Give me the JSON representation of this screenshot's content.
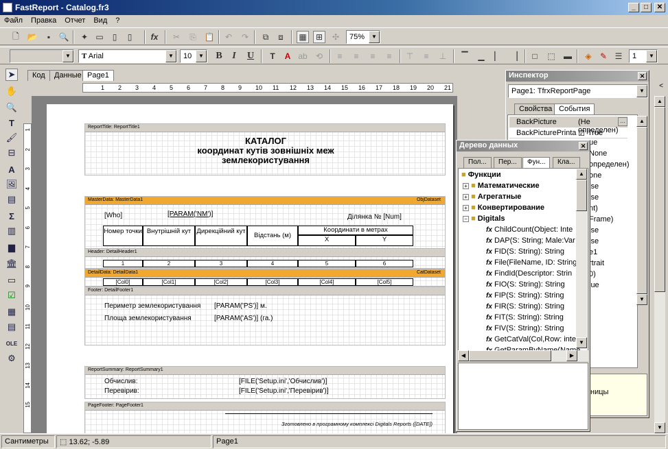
{
  "window": {
    "title": "FastReport - Catalog.fr3",
    "min": "_",
    "max": "□",
    "close": "✕"
  },
  "menu": [
    "Файл",
    "Правка",
    "Отчет",
    "Вид",
    "?"
  ],
  "toolbar": {
    "zoom": "75%",
    "font": "Arial",
    "size": "10",
    "linewidth": "1",
    "bold": "B",
    "italic": "I",
    "underline": "U"
  },
  "tabs": [
    "Код",
    "Данные",
    "Page1"
  ],
  "ruler": [
    "1",
    "2",
    "3",
    "4",
    "5",
    "6",
    "7",
    "8",
    "9",
    "10",
    "11",
    "12",
    "13",
    "14",
    "15",
    "16",
    "17",
    "18",
    "19",
    "20",
    "21"
  ],
  "vruler": [
    "1",
    "2",
    "3",
    "4",
    "5",
    "6",
    "7",
    "8",
    "9",
    "10",
    "11",
    "12",
    "13",
    "14",
    "15"
  ],
  "report": {
    "title_band": "ReportTitle: ReportTitle1",
    "title_lines": [
      "КАТАЛОГ",
      "координат кутів зовнішніх меж",
      "землекористування"
    ],
    "master_band": "MasterData: MasterData1",
    "master_ds": "ObjDataset",
    "who": "[Who]",
    "nm": "[PARAM('NM')]",
    "dilanka": "Ділянка № [Num]",
    "headers": [
      "Номер точки",
      "Внутрішній кут",
      "Дирекційний кут",
      "Відстань (м)",
      "Координати в метрах",
      "X",
      "Y"
    ],
    "header_band": "Header: DetailHeader1",
    "nums": [
      "1",
      "2",
      "3",
      "4",
      "5",
      "6"
    ],
    "detail_band": "DetailData: DetailData1",
    "detail_ds": "CatDataset",
    "cols": [
      "[Col0]",
      "[Col1]",
      "[Col2]",
      "[Col3]",
      "[Col4]",
      "[Col5]"
    ],
    "footer_band": "Footer: DetailFooter1",
    "perimetr": "Периметр землекористування",
    "perimetr_val": "[PARAM('PS')] м.",
    "plosha": "Площа землекористування",
    "plosha_val": "[PARAM('AS')] (га.)",
    "summary_band": "ReportSummary: ReportSummary1",
    "obchyslyv": "Обчислив:",
    "obchyslyv_val": "[FILE('Setup.ini','Обчислив')]",
    "pereviryv": "Перевірив:",
    "pereviryv_val": "[FILE('Setup.ini','Перевірив')]",
    "pagefooter_band": "PageFooter: PageFooter1",
    "pagefooter_text": "Зготовлено в програмному комплексі Digitals Reports ([DATE])"
  },
  "inspector": {
    "title": "Инспектор",
    "object": "Page1: TfrxReportPage",
    "tab_props": "Свойства",
    "tab_events": "События",
    "rows": [
      {
        "name": "BackPicture",
        "value": "(Не определен)"
      },
      {
        "name": "BackPicturePrinta",
        "value": "True"
      }
    ],
    "partial_values": [
      "ue",
      "None",
      "определен)",
      "one",
      "lse",
      "lse",
      "nt)",
      "Frame)",
      "lse",
      "lse",
      "e1",
      "rtrait",
      "0)",
      "lue"
    ],
    "desc": "ницы"
  },
  "datatree": {
    "title": "Дерево данных",
    "tabs": [
      "Пол...",
      "Пер...",
      "Фун...",
      "Кла..."
    ],
    "root": "Функции",
    "groups": [
      "Математические",
      "Агрегатные",
      "Конвертирование",
      "Digitals"
    ],
    "funcs": [
      "ChildCount(Object: Inte",
      "DAP(S: String; Male:Var",
      "FID(S: String): String",
      "File(FileName, ID: String",
      "FindId(Descriptor: Strin",
      "FIO(S: String): String",
      "FIP(S: String): String",
      "FIR(S: String): String",
      "FIT(S: String): String",
      "FIV(S: String): String",
      "GetCatVal(Col,Row: inte",
      "GetParamByName(Name"
    ]
  },
  "status": {
    "units": "Сантиметры",
    "coords": "13.62; -5.89",
    "page": "Page1"
  }
}
